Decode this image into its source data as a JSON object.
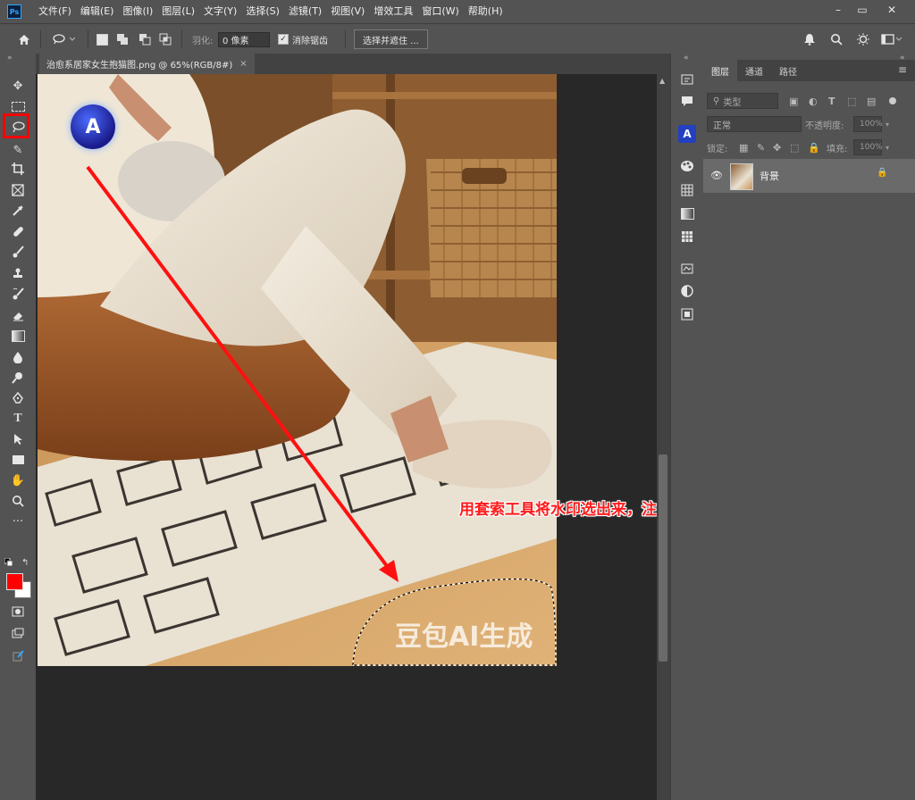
{
  "app": {
    "logo": "Ps"
  },
  "menu": [
    "文件(F)",
    "编辑(E)",
    "图像(I)",
    "图层(L)",
    "文字(Y)",
    "选择(S)",
    "滤镜(T)",
    "视图(V)",
    "增效工具",
    "窗口(W)",
    "帮助(H)"
  ],
  "options": {
    "feather_label": "羽化:",
    "feather_value": "0 像素",
    "antialias_label": "消除锯齿",
    "antialias_checked": true,
    "select_mask_button": "选择并遮住 ..."
  },
  "document": {
    "tab_title": "治愈系居家女生抱猫图.png @ 65%(RGB/8#)",
    "watermark_text": "豆包AI生成"
  },
  "layers_panel": {
    "tabs": [
      "图层",
      "通道",
      "路径"
    ],
    "active_tab": "图层",
    "filter_kind": "类型",
    "blend_mode": "正常",
    "opacity_label": "不透明度:",
    "opacity_value": "100%",
    "lock_label": "锁定:",
    "fill_label": "填充:",
    "fill_value": "100%",
    "layers": [
      {
        "name": "背景",
        "visible": true,
        "locked": true
      }
    ]
  },
  "annotation": {
    "text": "用套索工具将水印选出来，注意可以多画一些，多一点参考空间",
    "color": "#ff1a1a"
  },
  "colors": {
    "foreground": "#ff0000",
    "background": "#ffffff",
    "highlight_box": "#ff0000"
  }
}
